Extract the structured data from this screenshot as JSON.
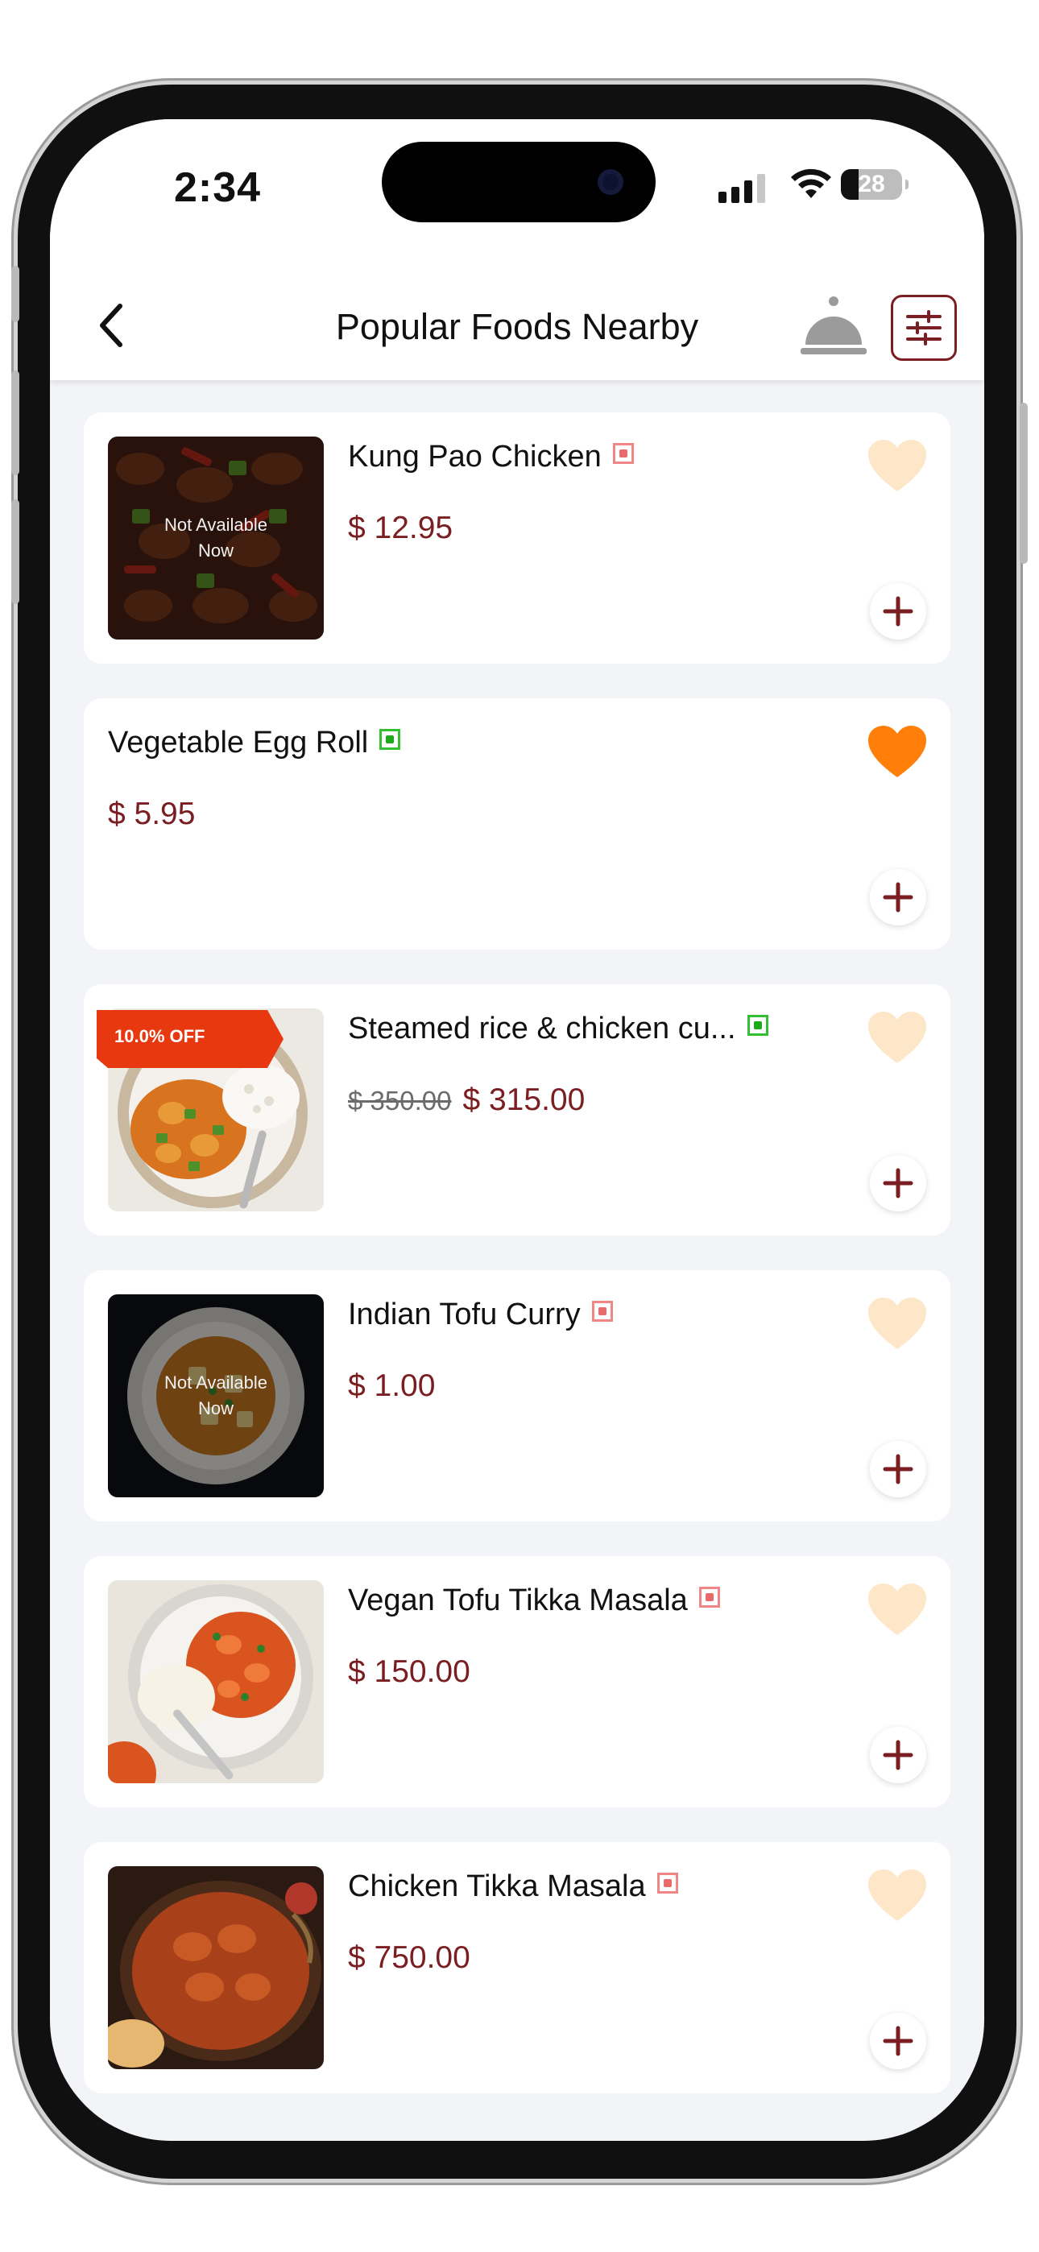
{
  "status_bar": {
    "time": "2:34",
    "battery": "28"
  },
  "header": {
    "title": "Popular Foods Nearby"
  },
  "labels": {
    "not_available": "Not Available Now"
  },
  "colors": {
    "brand": "#7a1e22",
    "favorite_on": "#ff7f0a",
    "favorite_off": "#fde7c8",
    "discount_badge": "#e8380f"
  },
  "items": [
    {
      "name": "Kung Pao Chicken",
      "type": "nonveg",
      "price": "$ 12.95",
      "image": "kung-pao-chicken",
      "available": false,
      "favorite": false
    },
    {
      "name": "Vegetable Egg Roll",
      "type": "veg",
      "price": "$ 5.95",
      "image": null,
      "available": true,
      "favorite": true
    },
    {
      "name": "Steamed rice & chicken cu...",
      "type": "veg",
      "old_price": "$ 350.00",
      "price": "$ 315.00",
      "discount": "10.0% OFF",
      "image": "rice-chicken-curry",
      "available": true,
      "favorite": false
    },
    {
      "name": "Indian Tofu Curry",
      "type": "nonveg",
      "price": "$ 1.00",
      "image": "tofu-curry",
      "available": false,
      "favorite": false
    },
    {
      "name": "Vegan Tofu Tikka Masala",
      "type": "nonveg",
      "price": "$ 150.00",
      "image": "tofu-tikka-masala",
      "available": true,
      "favorite": false
    },
    {
      "name": "Chicken Tikka Masala",
      "type": "nonveg",
      "price": "$ 750.00",
      "image": "chicken-tikka-masala",
      "available": true,
      "favorite": false
    }
  ]
}
